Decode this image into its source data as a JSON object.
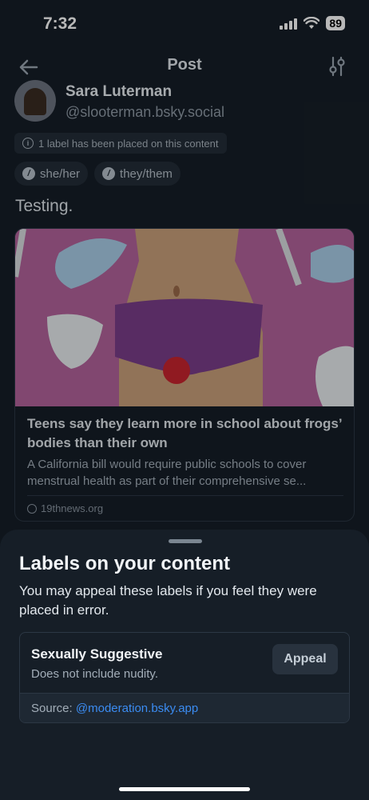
{
  "status_bar": {
    "time": "7:32",
    "battery": "89"
  },
  "nav": {
    "title": "Post"
  },
  "author": {
    "name": "Sara Luterman",
    "handle": "@slooterman.bsky.social"
  },
  "label_notice": "1 label has been placed on this content",
  "pronouns": [
    "she/her",
    "they/them"
  ],
  "post": {
    "text": "Testing."
  },
  "embed": {
    "title": "Teens say they learn more in school about frogs’ bodies than their own",
    "description": "A California bill would require public schools to cover menstrual health as part of their comprehensive se...",
    "domain": "19thnews.org"
  },
  "sheet": {
    "title": "Labels on your content",
    "subtitle": "You may appeal these labels if you feel they were placed in error.",
    "label": {
      "name": "Sexually Suggestive",
      "description": "Does not include nudity.",
      "appeal_label": "Appeal",
      "source_prefix": "Source: ",
      "source_link": "@moderation.bsky.app"
    }
  },
  "colors": {
    "accent": "#3b8cf2",
    "background": "#161e27"
  }
}
